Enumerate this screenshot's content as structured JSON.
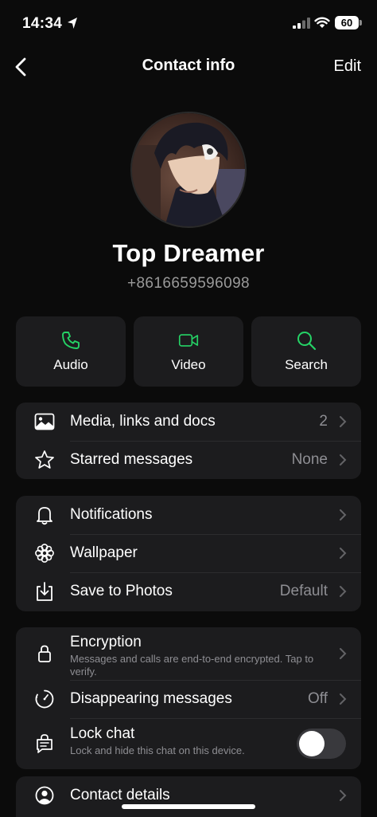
{
  "status_bar": {
    "time": "14:34",
    "battery": "60"
  },
  "nav": {
    "title": "Contact info",
    "edit_label": "Edit"
  },
  "profile": {
    "name": "Top Dreamer",
    "phone": "+8616659596098"
  },
  "actions": [
    {
      "label": "Audio",
      "icon": "phone-icon"
    },
    {
      "label": "Video",
      "icon": "video-icon"
    },
    {
      "label": "Search",
      "icon": "search-icon"
    }
  ],
  "media_group": [
    {
      "label": "Media, links and docs",
      "value": "2",
      "icon": "image-icon"
    },
    {
      "label": "Starred messages",
      "value": "None",
      "icon": "star-icon"
    }
  ],
  "settings_group": [
    {
      "label": "Notifications",
      "value": "",
      "icon": "bell-icon"
    },
    {
      "label": "Wallpaper",
      "value": "",
      "icon": "flower-icon"
    },
    {
      "label": "Save to Photos",
      "value": "Default",
      "icon": "download-icon"
    }
  ],
  "privacy_group": {
    "encryption": {
      "label": "Encryption",
      "sub": "Messages and calls are end-to-end encrypted. Tap to verify."
    },
    "disappearing": {
      "label": "Disappearing messages",
      "value": "Off"
    },
    "lock_chat": {
      "label": "Lock chat",
      "sub": "Lock and hide this chat on this device.",
      "enabled": false
    }
  },
  "contact_details": {
    "label": "Contact details"
  },
  "colors": {
    "accent": "#25d366",
    "card": "#1c1c1e",
    "secondary_text": "#8e8e93"
  }
}
